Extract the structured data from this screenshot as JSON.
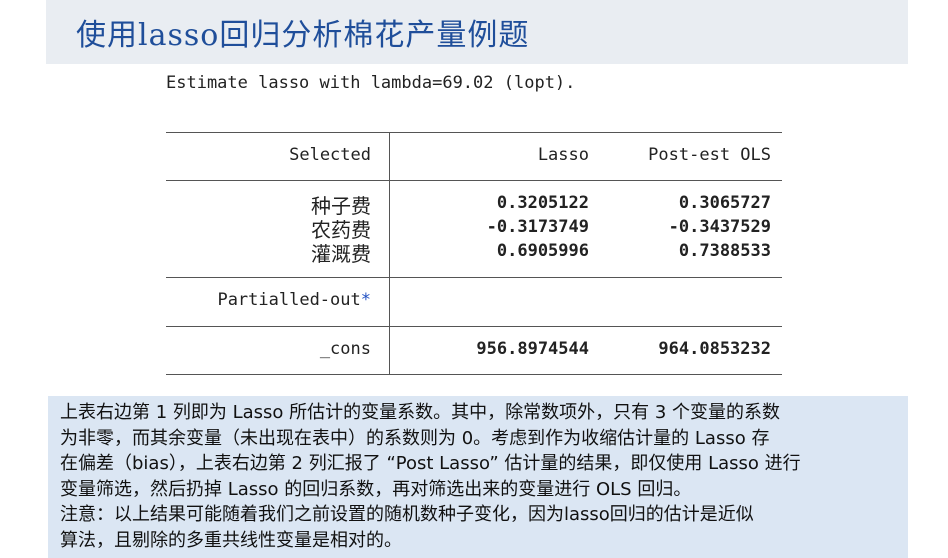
{
  "header": {
    "title": "使用lasso回归分析棉花产量例题"
  },
  "estimate_line": "Estimate lasso with lambda=69.02 (lopt).",
  "table": {
    "headers": {
      "selected": "Selected",
      "lasso": "Lasso",
      "post_est_ols": "Post-est OLS"
    },
    "rows": [
      {
        "label": "种子费",
        "lasso": "0.3205122",
        "ols": "0.3065727"
      },
      {
        "label": "农药费",
        "lasso": "-0.3173749",
        "ols": "-0.3437529"
      },
      {
        "label": "灌溉费",
        "lasso": "0.6905996",
        "ols": "0.7388533"
      }
    ],
    "partialled_out_label": "Partialled-out",
    "partialled_out_star": "*",
    "cons": {
      "label": "_cons",
      "lasso": "956.8974544",
      "ols": "964.0853232"
    }
  },
  "note": {
    "lines": [
      "上表右边第 1 列即为 Lasso 所估计的变量系数。其中，除常数项外，只有 3 个变量的系数",
      "为非零，而其余变量（未出现在表中）的系数则为 0。考虑到作为收缩估计量的 Lasso 存",
      "在偏差（bias），上表右边第 2 列汇报了 “Post Lasso” 估计量的结果，即仅使用 Lasso 进行",
      "变量筛选，然后扔掉 Lasso 的回归系数，再对筛选出来的变量进行 OLS 回归。",
      "注意：以上结果可能随着我们之前设置的随机数种子变化，因为lasso回归的估计是近似",
      "算法，且剔除的多重共线性变量是相对的。"
    ]
  }
}
